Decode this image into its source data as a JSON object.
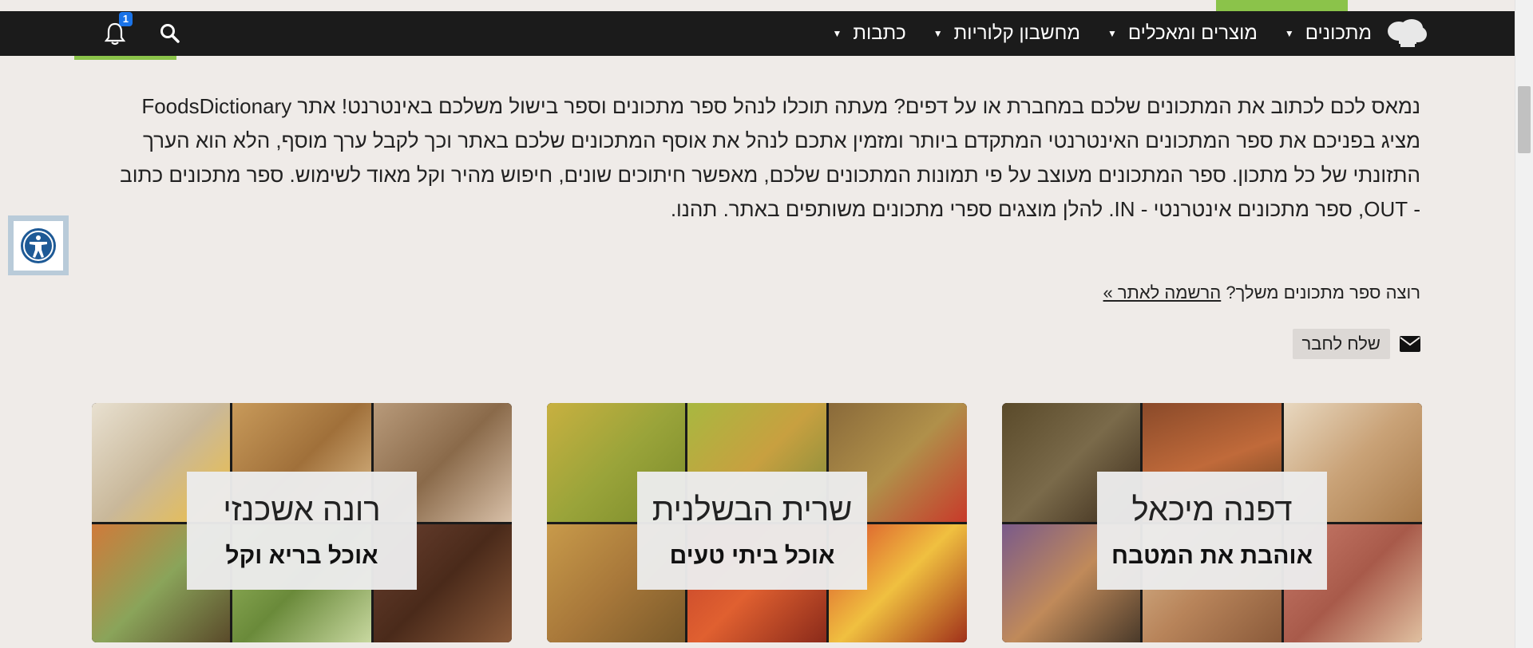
{
  "nav": {
    "items": [
      {
        "label": "מתכונים",
        "has_dropdown": true
      },
      {
        "label": "מוצרים ומאכלים",
        "has_dropdown": true
      },
      {
        "label": "מחשבון קלוריות",
        "has_dropdown": true
      },
      {
        "label": "כתבות",
        "has_dropdown": true
      }
    ],
    "notification_count": "1"
  },
  "intro": {
    "text": "נמאס לכם לכתוב את המתכונים שלכם במחברת או על דפים? מעתה תוכלו לנהל ספר מתכונים וספר בישול משלכם באינטרנט! אתר FoodsDictionary מציג בפניכם את ספר המתכונים האינטרנטי המתקדם ביותר ומזמין אתכם לנהל את אוסף המתכונים שלכם באתר וכך לקבל ערך מוסף, הלא הוא הערך התזונתי של כל מתכון. ספר המתכונים מעוצב על פי תמונות המתכונים שלכם, מאפשר חיתוכים שונים, חיפוש מהיר וקל מאוד לשימוש. ספר מתכונים כתוב - OUT, ספר מתכונים אינטרנטי - IN. להלן מוצגים ספרי מתכונים משותפים באתר. תהנו."
  },
  "signup": {
    "question": "רוצה ספר מתכונים משלך?",
    "link": "הרשמה לאתר »"
  },
  "share": {
    "label": "שלח לחבר"
  },
  "cards": [
    {
      "name": "דפנה מיכאל",
      "tagline": "אוהבת את המטבח",
      "tiles": [
        "#6b5a3a",
        "#8a5a2c",
        "#c9a277",
        "#7a5a3c",
        "#c98a6a",
        "#c07a5a"
      ]
    },
    {
      "name": "שרית הבשלנית",
      "tagline": "אוכל ביתי טעים",
      "tiles": [
        "#b8a23a",
        "#9aa43a",
        "#9a7a4a",
        "#c89a4a",
        "#c0402a",
        "#b83a2a"
      ]
    },
    {
      "name": "רונה אשכנזי",
      "tagline": "אוכל בריא וקל",
      "tiles": [
        "#d8cfc2",
        "#b8844a",
        "#a8886a",
        "#7a6a4a",
        "#8aa45a",
        "#5a3a2a"
      ]
    }
  ]
}
